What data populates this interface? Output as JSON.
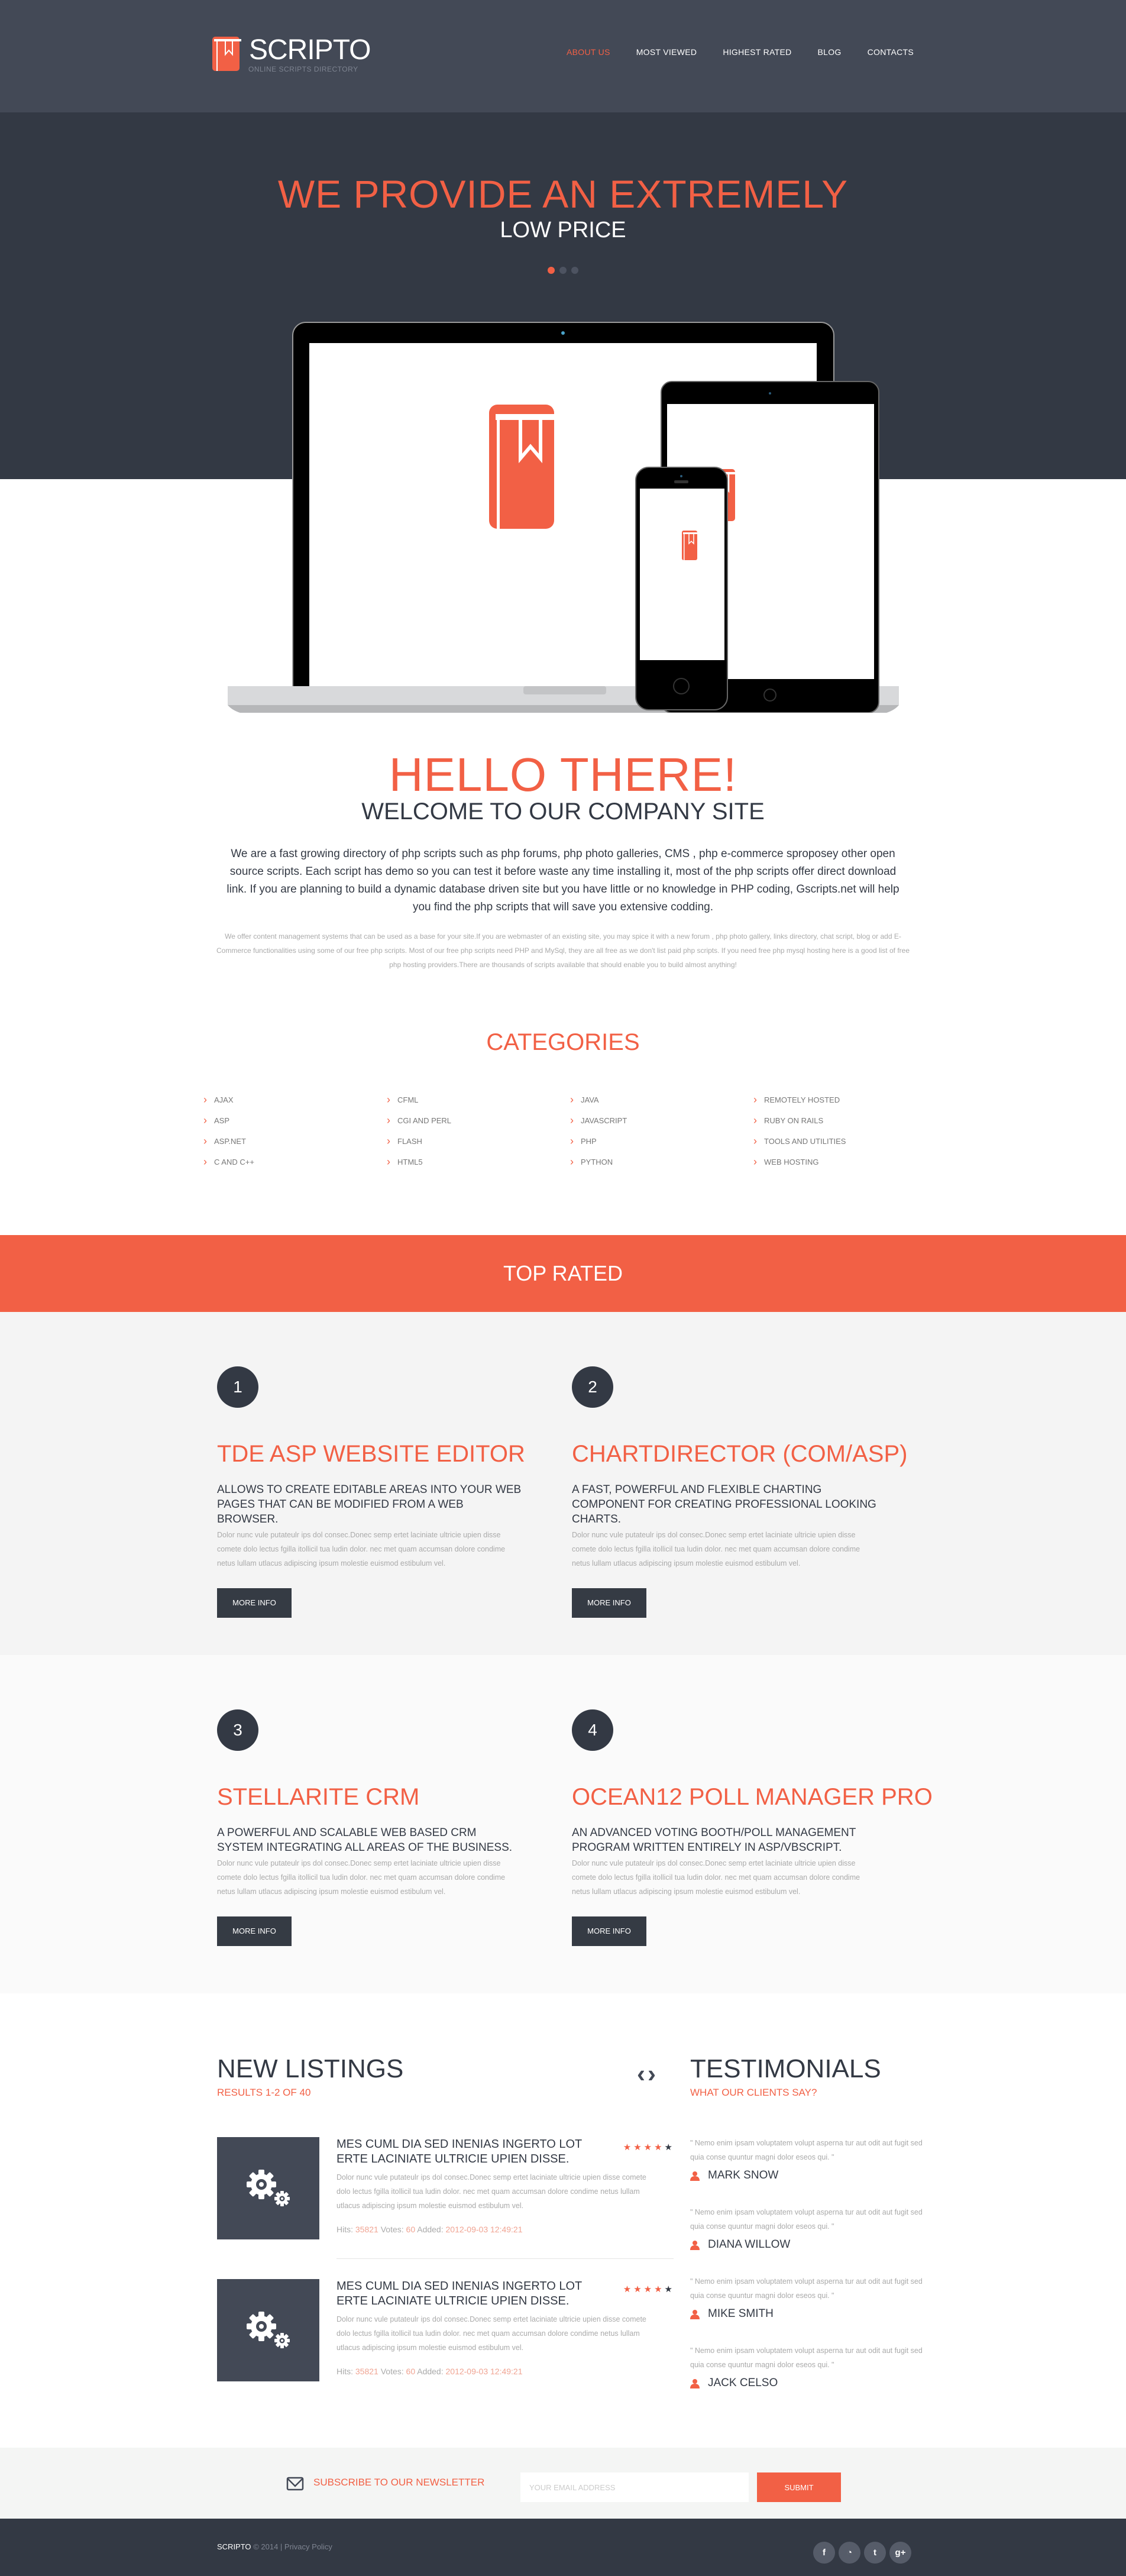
{
  "header": {
    "logo_title": "SCRIPTO",
    "logo_subtitle": "ONLINE SCRIPTS DIRECTORY",
    "nav": [
      {
        "label": "ABOUT US",
        "active": true
      },
      {
        "label": "MOST VIEWED",
        "active": false
      },
      {
        "label": "HIGHEST RATED",
        "active": false
      },
      {
        "label": "BLOG",
        "active": false
      },
      {
        "label": "CONTACTS",
        "active": false
      }
    ]
  },
  "hero": {
    "title": "WE PROVIDE AN EXTREMELY",
    "subtitle": "LOW PRICE",
    "slides": 3,
    "active_slide": 1,
    "illustration": "responsive-devices-book-icon"
  },
  "intro": {
    "hello": "HELLO THERE!",
    "welcome": "WELCOME TO OUR COMPANY SITE",
    "lead": "We are a fast growing directory of php scripts such as php forums, php photo galleries, CMS , php e-commerce sproposey other open source scripts. Each script has demo so you can test it before waste any time installing it, most of the php scripts offer direct download link. If you are planning to build a dynamic database driven site but you have little or no knowledge in PHP coding, Gscripts.net will help you find the php scripts that will save you extensive codding.",
    "detail": "We offer content management systems that can be used as a base for your site.If you are webmaster of an existing site, you may spice it with a new forum , php photo gallery, links directory, chat script, blog or add E-Commerce functionalities using some of our free php scripts. Most of our free php scripts need PHP and MySql, they are all free as we don't list paid php scripts. If you need free php mysql hosting here is a good list of free php hosting providers.There are thousands of scripts available that should enable you to build almost anything!"
  },
  "categories": {
    "title": "CATEGORIES",
    "columns": [
      [
        "AJAX",
        "ASP",
        "ASP.NET",
        "C AND C++"
      ],
      [
        "CFML",
        "CGI AND PERL",
        "FLASH",
        "HTML5"
      ],
      [
        "JAVA",
        "JAVASCRIPT",
        "PHP",
        "PYTHON"
      ],
      [
        "REMOTELY HOSTED",
        "RUBY ON RAILS",
        "TOOLS AND UTILITIES",
        "WEB HOSTING"
      ]
    ]
  },
  "top_rated": {
    "title": "TOP RATED",
    "button_label": "MORE INFO",
    "items": [
      {
        "num": "1",
        "name": "TDE ASP WEBSITE EDITOR",
        "desc": "ALLOWS TO CREATE EDITABLE AREAS INTO YOUR WEB PAGES THAT CAN BE MODIFIED FROM A WEB BROWSER.",
        "body": "Dolor nunc vule putateulr ips dol consec.Donec semp ertet laciniate ultricie upien disse comete dolo lectus fgilla itollicil tua ludin dolor. nec met quam accumsan dolore condime netus lullam utlacus adipiscing ipsum molestie euismod estibulum vel."
      },
      {
        "num": "2",
        "name": "CHARTDIRECTOR (COM/ASP)",
        "desc": "A FAST, POWERFUL AND FLEXIBLE CHARTING COMPONENT FOR CREATING PROFESSIONAL LOOKING CHARTS.",
        "body": "Dolor nunc vule putateulr ips dol consec.Donec semp ertet laciniate ultricie upien disse comete dolo lectus fgilla itollicil tua ludin dolor. nec met quam accumsan dolore condime netus lullam utlacus adipiscing ipsum molestie euismod estibulum vel."
      },
      {
        "num": "3",
        "name": "STELLARITE CRM",
        "desc": "A POWERFUL AND SCALABLE WEB BASED CRM SYSTEM INTEGRATING ALL AREAS OF THE BUSINESS.",
        "body": "Dolor nunc vule putateulr ips dol consec.Donec semp ertet laciniate ultricie upien disse comete dolo lectus fgilla itollicil tua ludin dolor. nec met quam accumsan dolore condime netus lullam utlacus adipiscing ipsum molestie euismod estibulum vel."
      },
      {
        "num": "4",
        "name": "OCEAN12 POLL MANAGER PRO",
        "desc": "AN ADVANCED VOTING BOOTH/POLL MANAGEMENT PROGRAM WRITTEN ENTIRELY IN ASP/VBSCRIPT.",
        "body": "Dolor nunc vule putateulr ips dol consec.Donec semp ertet laciniate ultricie upien disse comete dolo lectus fgilla itollicil tua ludin dolor. nec met quam accumsan dolore condime netus lullam utlacus adipiscing ipsum molestie euismod estibulum vel."
      }
    ]
  },
  "new_listings": {
    "title": "NEW LISTINGS",
    "results": "RESULTS 1-2 OF 40",
    "prev_icon": "chevron-left-icon",
    "next_icon": "chevron-right-icon",
    "items": [
      {
        "title": "MES CUML DIA SED INENIAS INGERTO LOT ERTE LACINIATE ULTRICIE UPIEN DISSE.",
        "rating": 4,
        "rating_max": 5,
        "body": "Dolor nunc vule putateulr ips dol consec.Donec semp ertet laciniate ultricie upien disse comete dolo lectus fgilla itollicil tua ludin dolor. nec met quam accumsan dolore condime netus lullam utlacus adipiscing ipsum molestie euismod estibulum vel.",
        "hits_label": "Hits:",
        "hits": "35821",
        "votes_label": "Votes:",
        "votes": "60",
        "added_label": "Added:",
        "added": "2012-09-03 12:49:21"
      },
      {
        "title": "MES CUML DIA SED INENIAS INGERTO LOT ERTE LACINIATE ULTRICIE UPIEN DISSE.",
        "rating": 4,
        "rating_max": 5,
        "body": "Dolor nunc vule putateulr ips dol consec.Donec semp ertet laciniate ultricie upien disse comete dolo lectus fgilla itollicil tua ludin dolor. nec met quam accumsan dolore condime netus lullam utlacus adipiscing ipsum molestie euismod estibulum vel.",
        "hits_label": "Hits:",
        "hits": "35821",
        "votes_label": "Votes:",
        "votes": "60",
        "added_label": "Added:",
        "added": "2012-09-03 12:49:21"
      }
    ]
  },
  "testimonials": {
    "title": "TESTIMONIALS",
    "subtitle": "WHAT OUR CLIENTS SAY?",
    "items": [
      {
        "quote": "\" Nemo enim ipsam voluptatem volupt asperna tur aut odit aut fugit sed quia conse quuntur magni dolor eseos qui. \"",
        "author": "MARK SNOW"
      },
      {
        "quote": "\" Nemo enim ipsam voluptatem volupt asperna tur aut odit aut fugit sed quia conse quuntur magni dolor eseos qui. \"",
        "author": "DIANA WILLOW"
      },
      {
        "quote": "\" Nemo enim ipsam voluptatem volupt asperna tur aut odit aut fugit sed quia conse quuntur magni dolor eseos qui. \"",
        "author": "MIKE SMITH"
      },
      {
        "quote": "\" Nemo enim ipsam voluptatem volupt asperna tur aut odit aut fugit sed quia conse quuntur magni dolor eseos qui. \"",
        "author": "JACK CELSO"
      }
    ]
  },
  "newsletter": {
    "label": "SUBSCRIBE TO OUR NEWSLETTER",
    "placeholder": "YOUR EMAIL ADDRESS",
    "value": "",
    "submit": "SUBMIT"
  },
  "footer": {
    "brand": "SCRIPTO",
    "copyright": "© 2014 |",
    "privacy": "Privacy Policy",
    "socials": [
      {
        "name": "facebook-icon",
        "glyph": "f"
      },
      {
        "name": "rss-icon",
        "glyph": "◔"
      },
      {
        "name": "twitter-icon",
        "glyph": "t"
      },
      {
        "name": "google-plus-icon",
        "glyph": "g+"
      }
    ]
  },
  "colors": {
    "accent": "#f26045",
    "dark": "#333944",
    "header_bg": "#434956",
    "top_rated_bg_1": "#f4f4f4",
    "top_rated_bg_2": "#fafafa"
  }
}
